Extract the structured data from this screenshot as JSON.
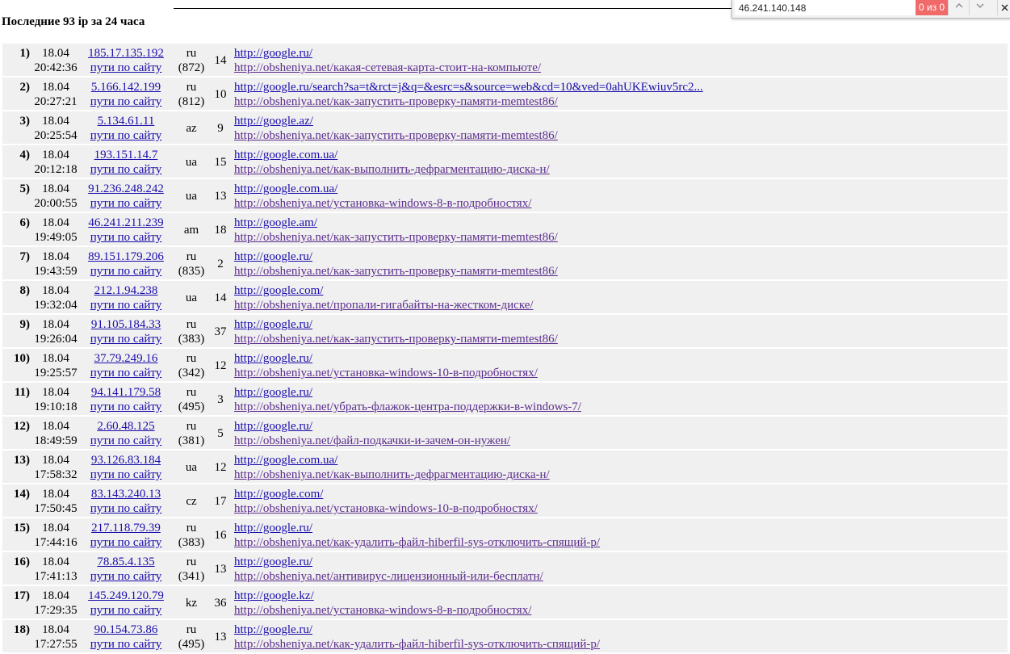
{
  "header": {
    "title": "Последние 93 ip за 24 часа"
  },
  "find_bar": {
    "query": "46.241.140.148",
    "count": "0 из 0",
    "prev_icon": "chevron-up-icon",
    "next_icon": "chevron-down-icon",
    "close_icon": "close-icon"
  },
  "rows": [
    {
      "num": "1)",
      "date": "18.04",
      "time": "20:42:36",
      "ip": "185.17.135.192",
      "paths": "пути по сайту",
      "cc": "ru",
      "asn": "(872)",
      "count": "14",
      "referrer": "http://google.ru/",
      "page": "http://obsheniya.net/какая-сетевая-карта-стоит-на-компьюте/"
    },
    {
      "num": "2)",
      "date": "18.04",
      "time": "20:27:21",
      "ip": "5.166.142.199",
      "paths": "пути по сайту",
      "cc": "ru",
      "asn": "(812)",
      "count": "10",
      "referrer": "http://google.ru/search?sa=t&rct=j&q=&esrc=s&source=web&cd=10&ved=0ahUKEwiuv5rc2...",
      "page": "http://obsheniya.net/как-запустить-проверку-памяти-memtest86/"
    },
    {
      "num": "3)",
      "date": "18.04",
      "time": "20:25:54",
      "ip": "5.134.61.11",
      "paths": "пути по сайту",
      "cc": "az",
      "asn": "",
      "count": "9",
      "referrer": "http://google.az/",
      "page": "http://obsheniya.net/как-запустить-проверку-памяти-memtest86/"
    },
    {
      "num": "4)",
      "date": "18.04",
      "time": "20:12:18",
      "ip": "193.151.14.7",
      "paths": "пути по сайту",
      "cc": "ua",
      "asn": "",
      "count": "15",
      "referrer": "http://google.com.ua/",
      "page": "http://obsheniya.net/как-выполнить-дефрагментацию-диска-н/"
    },
    {
      "num": "5)",
      "date": "18.04",
      "time": "20:00:55",
      "ip": "91.236.248.242",
      "paths": "пути по сайту",
      "cc": "ua",
      "asn": "",
      "count": "13",
      "referrer": "http://google.com.ua/",
      "page": "http://obsheniya.net/установка-windows-8-в-подробностях/"
    },
    {
      "num": "6)",
      "date": "18.04",
      "time": "19:49:05",
      "ip": "46.241.211.239",
      "paths": "пути по сайту",
      "cc": "am",
      "asn": "",
      "count": "18",
      "referrer": "http://google.am/",
      "page": "http://obsheniya.net/как-запустить-проверку-памяти-memtest86/"
    },
    {
      "num": "7)",
      "date": "18.04",
      "time": "19:43:59",
      "ip": "89.151.179.206",
      "paths": "пути по сайту",
      "cc": "ru",
      "asn": "(835)",
      "count": "2",
      "referrer": "http://google.ru/",
      "page": "http://obsheniya.net/как-запустить-проверку-памяти-memtest86/"
    },
    {
      "num": "8)",
      "date": "18.04",
      "time": "19:32:04",
      "ip": "212.1.94.238",
      "paths": "пути по сайту",
      "cc": "ua",
      "asn": "",
      "count": "14",
      "referrer": "http://google.com/",
      "page": "http://obsheniya.net/пропали-гигабайты-на-жестком-диске/"
    },
    {
      "num": "9)",
      "date": "18.04",
      "time": "19:26:04",
      "ip": "91.105.184.33",
      "paths": "пути по сайту",
      "cc": "ru",
      "asn": "(383)",
      "count": "37",
      "referrer": "http://google.ru/",
      "page": "http://obsheniya.net/как-запустить-проверку-памяти-memtest86/"
    },
    {
      "num": "10)",
      "date": "18.04",
      "time": "19:25:57",
      "ip": "37.79.249.16",
      "paths": "пути по сайту",
      "cc": "ru",
      "asn": "(342)",
      "count": "12",
      "referrer": "http://google.ru/",
      "page": "http://obsheniya.net/установка-windows-10-в-подробностях/"
    },
    {
      "num": "11)",
      "date": "18.04",
      "time": "19:10:18",
      "ip": "94.141.179.58",
      "paths": "пути по сайту",
      "cc": "ru",
      "asn": "(495)",
      "count": "3",
      "referrer": "http://google.ru/",
      "page": "http://obsheniya.net/убрать-флажок-центра-поддержки-в-windows-7/"
    },
    {
      "num": "12)",
      "date": "18.04",
      "time": "18:49:59",
      "ip": "2.60.48.125",
      "paths": "пути по сайту",
      "cc": "ru",
      "asn": "(381)",
      "count": "5",
      "referrer": "http://google.ru/",
      "page": "http://obsheniya.net/файл-подкачки-и-зачем-он-нужен/"
    },
    {
      "num": "13)",
      "date": "18.04",
      "time": "17:58:32",
      "ip": "93.126.83.184",
      "paths": "пути по сайту",
      "cc": "ua",
      "asn": "",
      "count": "12",
      "referrer": "http://google.com.ua/",
      "page": "http://obsheniya.net/как-выполнить-дефрагментацию-диска-н/"
    },
    {
      "num": "14)",
      "date": "18.04",
      "time": "17:50:45",
      "ip": "83.143.240.13",
      "paths": "пути по сайту",
      "cc": "cz",
      "asn": "",
      "count": "17",
      "referrer": "http://google.com/",
      "page": "http://obsheniya.net/установка-windows-10-в-подробностях/"
    },
    {
      "num": "15)",
      "date": "18.04",
      "time": "17:44:16",
      "ip": "217.118.79.39",
      "paths": "пути по сайту",
      "cc": "ru",
      "asn": "(383)",
      "count": "16",
      "referrer": "http://google.ru/",
      "page": "http://obsheniya.net/как-удалить-файл-hiberfil-sys-отключить-спящий-р/"
    },
    {
      "num": "16)",
      "date": "18.04",
      "time": "17:41:13",
      "ip": "78.85.4.135",
      "paths": "пути по сайту",
      "cc": "ru",
      "asn": "(341)",
      "count": "13",
      "referrer": "http://google.ru/",
      "page": "http://obsheniya.net/антивирус-лицензионный-или-бесплатн/"
    },
    {
      "num": "17)",
      "date": "18.04",
      "time": "17:29:35",
      "ip": "145.249.120.79",
      "paths": "пути по сайту",
      "cc": "kz",
      "asn": "",
      "count": "36",
      "referrer": "http://google.kz/",
      "page": "http://obsheniya.net/установка-windows-8-в-подробностях/"
    },
    {
      "num": "18)",
      "date": "18.04",
      "time": "17:27:55",
      "ip": "90.154.73.86",
      "paths": "пути по сайту",
      "cc": "ru",
      "asn": "(495)",
      "count": "13",
      "referrer": "http://google.ru/",
      "page": "http://obsheniya.net/как-удалить-файл-hiberfil-sys-отключить-спящий-р/"
    }
  ]
}
